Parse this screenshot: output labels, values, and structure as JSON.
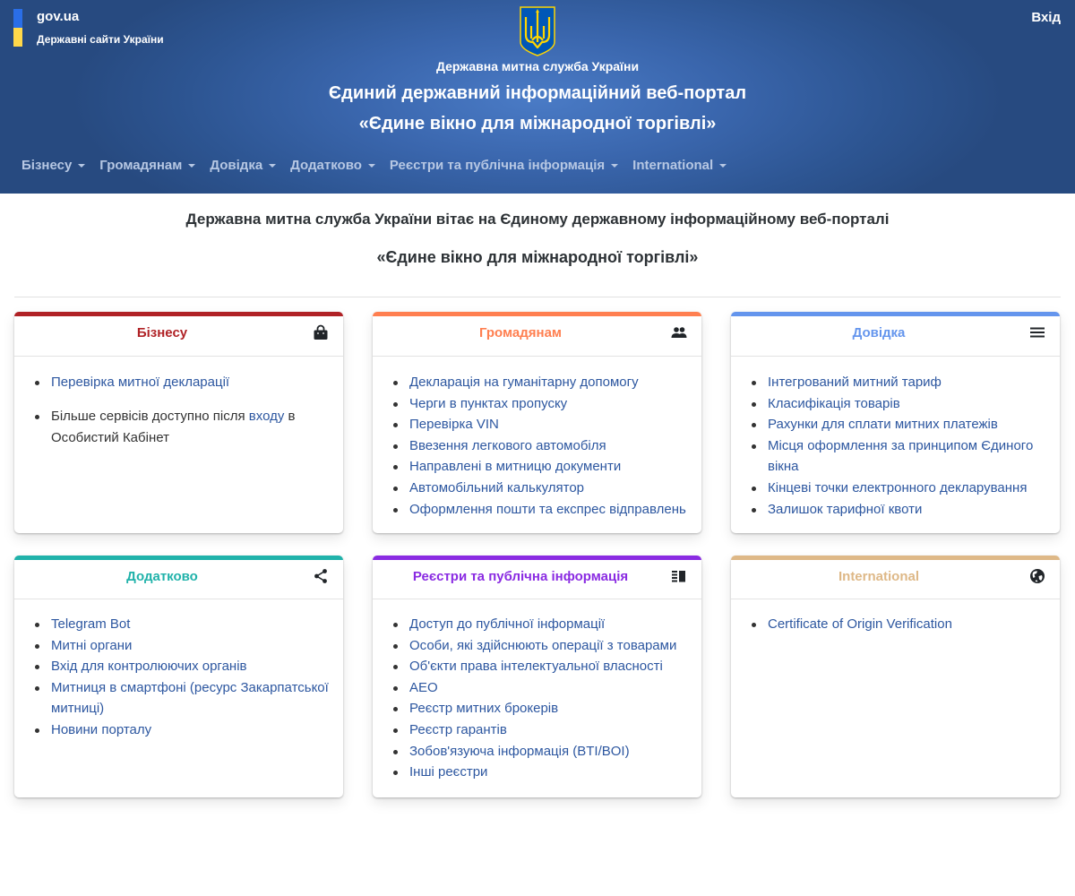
{
  "topbar": {
    "gov_label": "gov.ua",
    "gov_subtitle": "Державні сайти України",
    "login_label": "Вхід",
    "flag_colors": {
      "blue": "#2a6ee8",
      "yellow": "#ffd84a"
    }
  },
  "header": {
    "emblem": "trident-emblem",
    "agency": "Державна митна служба України",
    "title_line1": "Єдиний державний інформаційний веб-портал",
    "title_line2": "«Єдине вікно для міжнародної торгівлі»"
  },
  "nav": {
    "items": [
      {
        "label": "Бізнесу"
      },
      {
        "label": "Громадянам"
      },
      {
        "label": "Довідка"
      },
      {
        "label": "Додатково"
      },
      {
        "label": "Реєстри та публічна інформація"
      },
      {
        "label": "International"
      }
    ]
  },
  "welcome": {
    "line1": "Державна митна служба України вітає на Єдиному державному інформаційному веб-порталі",
    "line2": "«Єдине вікно для міжнародної торгівлі»"
  },
  "cards": [
    {
      "title": "Бізнесу",
      "icon": "shopping-bag-icon",
      "accent": "#b02226",
      "items": [
        "Перевірка митної декларації"
      ],
      "note": {
        "before": "Більше сервісів доступно після ",
        "link": "входу",
        "after": " в Особистий Кабінет"
      }
    },
    {
      "title": "Громадянам",
      "icon": "users-icon",
      "accent": "#ff7f50",
      "items": [
        "Декларація на гуманітарну допомогу",
        "Черги в пунктах пропуску",
        "Перевірка VIN",
        "Ввезення легкового автомобіля",
        "Направлені в митницю документи",
        "Автомобільний калькулятор",
        "Оформлення пошти та експрес відправлень"
      ]
    },
    {
      "title": "Довідка",
      "icon": "menu-icon",
      "accent": "#6495ed",
      "items": [
        "Інтегрований митний тариф",
        "Класифікація товарів",
        "Рахунки для сплати митних платежів",
        "Місця оформлення за принципом Єдиного вікна",
        "Кінцеві точки електронного декларування",
        "Залишок тарифної квоти"
      ]
    },
    {
      "title": "Додатково",
      "icon": "share-icon",
      "accent": "#20b2aa",
      "items": [
        "Telegram Bot",
        "Митні органи",
        "Вхід для контролюючих органів",
        "Митниця в смартфоні (ресурс Закарпатської митниці)",
        "Новини порталу"
      ]
    },
    {
      "title": "Реєстри та публічна інформація",
      "icon": "list-columns-icon",
      "accent": "#8a2be2",
      "items": [
        "Доступ до публічної інформації",
        "Особи, які здійснюють операції з товарами",
        "Об'єкти права інтелектуальної власності",
        "AEO",
        "Реєстр митних брокерів",
        "Реєстр гарантів",
        "Зобов'язуюча інформація (BTI/BOI)",
        "Інші реєстри"
      ]
    },
    {
      "title": "International",
      "icon": "globe-icon",
      "accent": "#deb887",
      "items": [
        "Certificate of Origin Verification"
      ]
    }
  ]
}
